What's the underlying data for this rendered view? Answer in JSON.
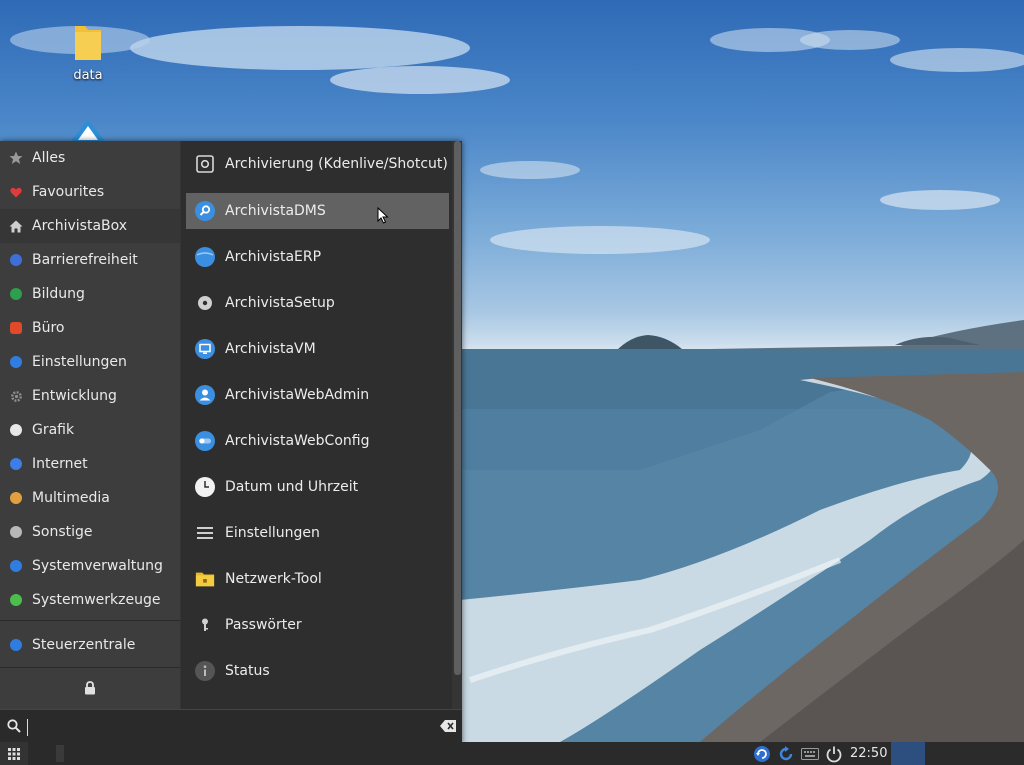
{
  "desktop": {
    "icons": [
      {
        "label": "data",
        "icon": "folder-icon"
      },
      {
        "label": "",
        "icon": "archivista-app-icon"
      }
    ]
  },
  "menu": {
    "categories": [
      {
        "label": "Alles",
        "icon": "star-icon",
        "color": "#9a9a9a"
      },
      {
        "label": "Favourites",
        "icon": "heart-icon",
        "color": "#e03b3b"
      },
      {
        "label": "ArchivistaBox",
        "icon": "home-icon",
        "color": "#cfcfcf"
      },
      {
        "label": "Barrierefreiheit",
        "icon": "accessibility-icon",
        "color": "#3f6fd6"
      },
      {
        "label": "Bildung",
        "icon": "education-icon",
        "color": "#2e9e4f"
      },
      {
        "label": "Büro",
        "icon": "office-icon",
        "color": "#e04a2a"
      },
      {
        "label": "Einstellungen",
        "icon": "settings-icon",
        "color": "#2f7de0"
      },
      {
        "label": "Entwicklung",
        "icon": "gear-icon",
        "color": "#8f8f8f"
      },
      {
        "label": "Grafik",
        "icon": "graphics-icon",
        "color": "#e8e8e8"
      },
      {
        "label": "Internet",
        "icon": "internet-icon",
        "color": "#3d7de8"
      },
      {
        "label": "Multimedia",
        "icon": "multimedia-icon",
        "color": "#e0a040"
      },
      {
        "label": "Sonstige",
        "icon": "other-icon",
        "color": "#b8b8b8"
      },
      {
        "label": "Systemverwaltung",
        "icon": "system-admin-icon",
        "color": "#2f7de0"
      },
      {
        "label": "Systemwerkzeuge",
        "icon": "system-tools-icon",
        "color": "#4cbe4c"
      },
      {
        "label": "Steuerzentrale",
        "icon": "control-center-icon",
        "color": "#2f7de0"
      }
    ],
    "apps": [
      {
        "label": "Archivierung (Kdenlive/Shotcut)",
        "icon": "archive-settings-icon"
      },
      {
        "label": "ArchivistaDMS",
        "icon": "search-circle-icon"
      },
      {
        "label": "ArchivistaERP",
        "icon": "erp-icon"
      },
      {
        "label": "ArchivistaSetup",
        "icon": "setup-disc-icon"
      },
      {
        "label": "ArchivistaVM",
        "icon": "monitor-icon"
      },
      {
        "label": "ArchivistaWebAdmin",
        "icon": "user-icon"
      },
      {
        "label": "ArchivistaWebConfig",
        "icon": "toggle-icon"
      },
      {
        "label": "Datum und Uhrzeit",
        "icon": "clock-icon"
      },
      {
        "label": "Einstellungen",
        "icon": "list-icon"
      },
      {
        "label": "Netzwerk-Tool",
        "icon": "network-folder-icon"
      },
      {
        "label": "Passwörter",
        "icon": "key-icon"
      },
      {
        "label": "Status",
        "icon": "info-icon"
      }
    ],
    "highlighted_app": "ArchivistaDMS",
    "search": {
      "value": "",
      "placeholder": ""
    }
  },
  "taskbar": {
    "clock": "22:50",
    "tray": [
      "update-icon",
      "refresh-icon",
      "keyboard-icon",
      "power-icon"
    ]
  },
  "colors": {
    "menu_bg": "#353535",
    "sidebar_bg": "#3d3d3d",
    "apps_bg": "#2e2e2e",
    "highlight": "#626262",
    "taskbar": "#2a2a2a",
    "accent": "#2d4f80"
  }
}
